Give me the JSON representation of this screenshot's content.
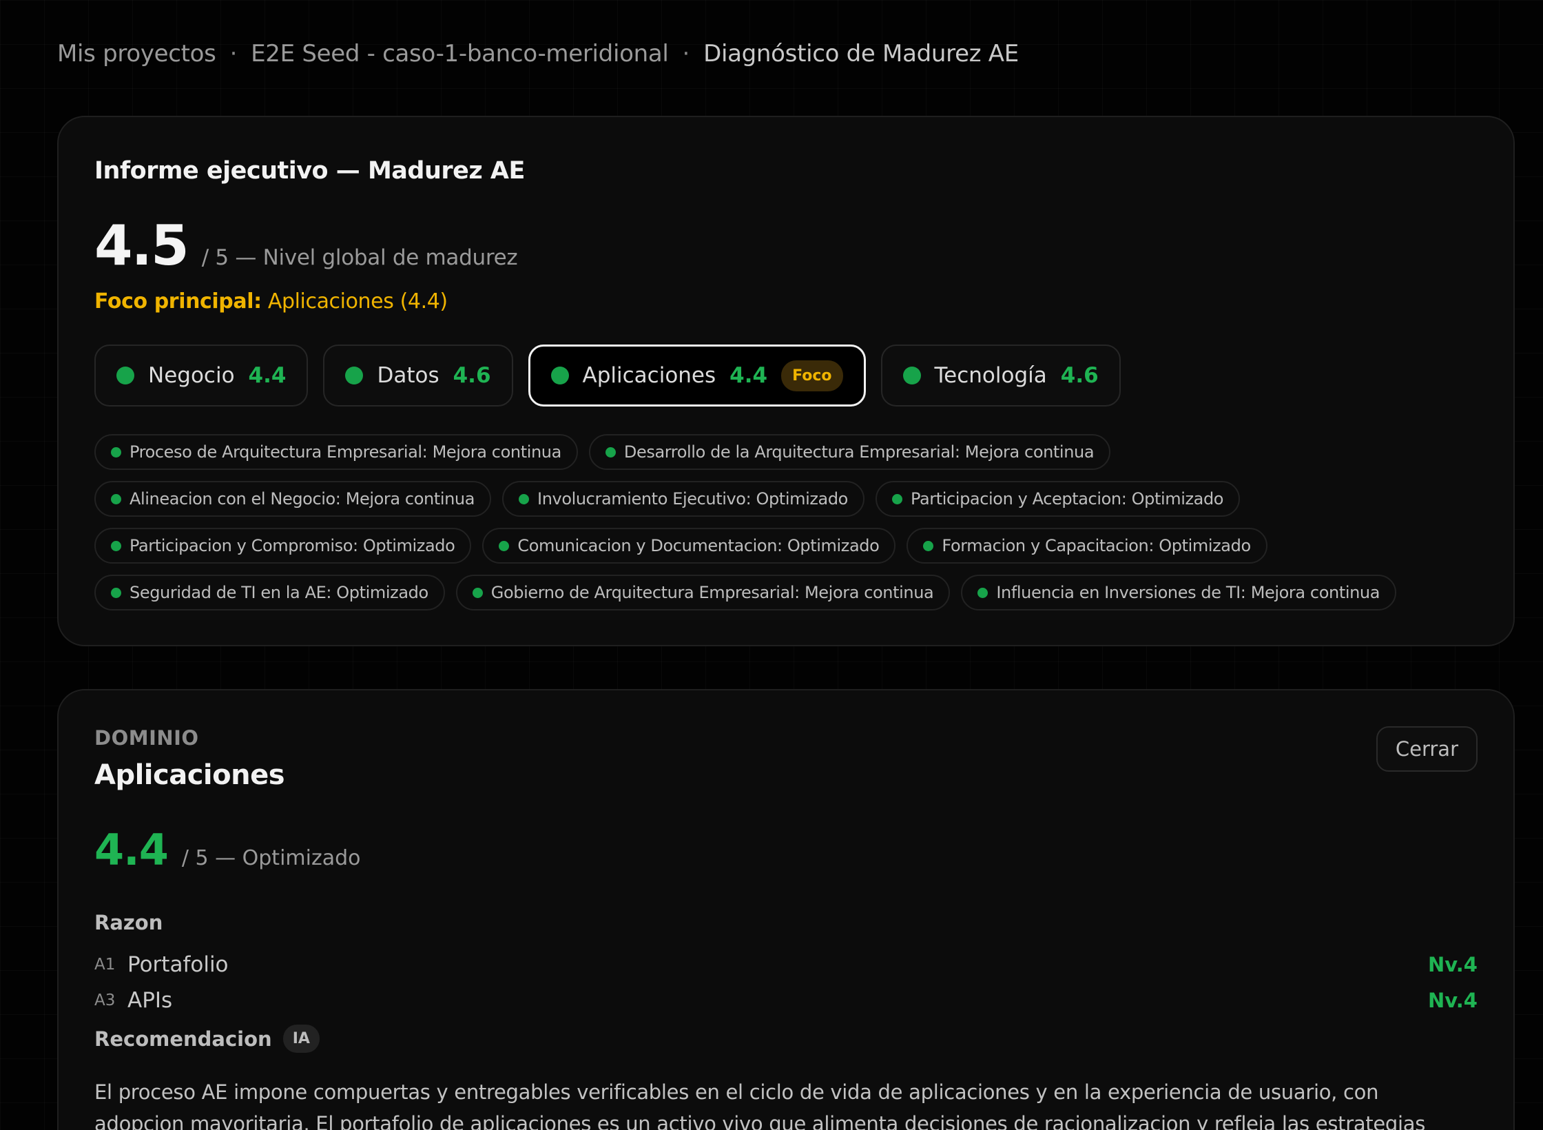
{
  "breadcrumb": {
    "items": [
      "Mis proyectos",
      "E2E Seed - caso-1-banco-meridional",
      "Diagnóstico de Madurez AE"
    ],
    "separator": "·"
  },
  "report": {
    "title": "Informe ejecutivo — Madurez AE",
    "score": "4.5",
    "score_suffix": "/ 5 — Nivel global de madurez",
    "focus_label": "Foco principal:",
    "focus_value": "Aplicaciones (4.4)",
    "domains": [
      {
        "name": "Negocio",
        "value": "4.4"
      },
      {
        "name": "Datos",
        "value": "4.6"
      },
      {
        "name": "Aplicaciones",
        "value": "4.4",
        "badge": "Foco"
      },
      {
        "name": "Tecnología",
        "value": "4.6"
      }
    ],
    "criteria": [
      "Proceso de Arquitectura Empresarial: Mejora continua",
      "Desarrollo de la Arquitectura Empresarial: Mejora continua",
      "Alineacion con el Negocio: Mejora continua",
      "Involucramiento Ejecutivo: Optimizado",
      "Participacion y Aceptacion: Optimizado",
      "Participacion y Compromiso: Optimizado",
      "Comunicacion y Documentacion: Optimizado",
      "Formacion y Capacitacion: Optimizado",
      "Seguridad de TI en la AE: Optimizado",
      "Gobierno de Arquitectura Empresarial: Mejora continua",
      "Influencia en Inversiones de TI: Mejora continua"
    ]
  },
  "domain_detail": {
    "eyebrow": "DOMINIO",
    "name": "Aplicaciones",
    "close_label": "Cerrar",
    "score": "4.4",
    "score_suffix": "/ 5 — Optimizado",
    "reason_title": "Razon",
    "reasons": [
      {
        "code": "A1",
        "name": "Portafolio",
        "level": "Nv.4"
      },
      {
        "code": "A3",
        "name": "APIs",
        "level": "Nv.4"
      }
    ],
    "recommendation_title": "Recomendacion",
    "recommendation_badge": "IA",
    "recommendation_text": "El proceso AE impone compuertas y entregables verificables en el ciclo de vida de aplicaciones y en la experiencia de usuario, con adopcion mayoritaria. El portafolio de aplicaciones es un activo vivo que alimenta decisiones de racionalizacion y refleja las estrategias corporativas."
  },
  "colors": {
    "accent_green": "#1fb453",
    "focus_yellow": "#f0b400",
    "background": "#020202",
    "card": "#0c0c0c"
  }
}
